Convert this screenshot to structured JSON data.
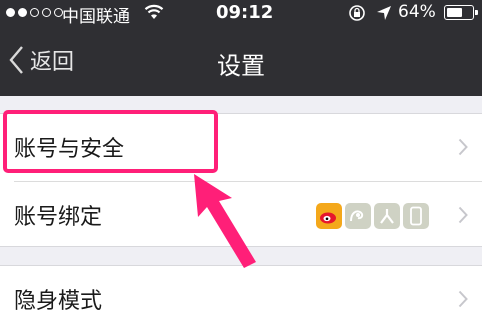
{
  "status_bar": {
    "carrier": "中国联通",
    "time": "09:12",
    "battery": "64%",
    "battery_level": 0.64
  },
  "nav": {
    "back_label": "返回",
    "title": "设置"
  },
  "settings": {
    "account_security": "账号与安全",
    "account_binding": "账号绑定",
    "stealth_mode": "隐身模式"
  },
  "binding_icons": [
    "weibo-icon",
    "tencent-weibo-icon",
    "person-icon",
    "phone-icon"
  ],
  "colors": {
    "nav_bg": "#2f2f33",
    "highlight": "#ff1f78",
    "page_bg": "#efeff4"
  }
}
